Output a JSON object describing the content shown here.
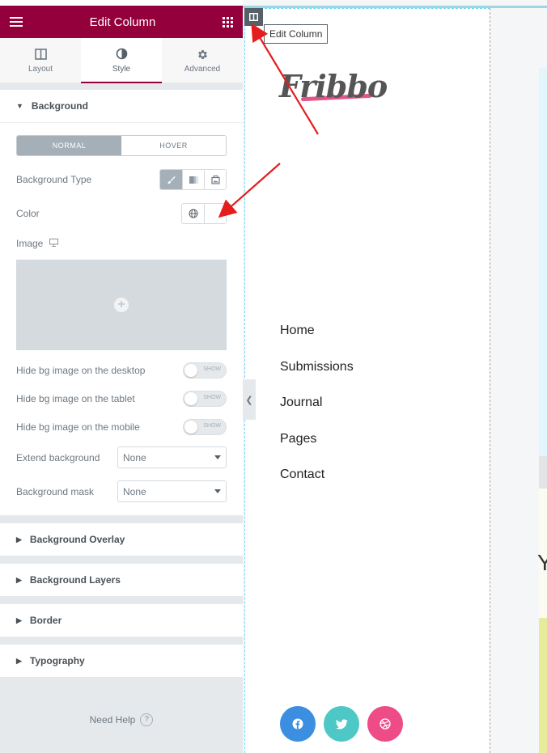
{
  "panel": {
    "title": "Edit Column",
    "tabs": [
      {
        "label": "Layout",
        "icon": "columns-icon"
      },
      {
        "label": "Style",
        "icon": "half-circle-icon",
        "active": true
      },
      {
        "label": "Advanced",
        "icon": "gear-icon"
      }
    ],
    "background": {
      "heading": "Background",
      "state_tabs": [
        "NORMAL",
        "HOVER"
      ],
      "bg_type_label": "Background Type",
      "color_label": "Color",
      "image_label": "Image",
      "toggles": [
        {
          "label": "Hide bg image on the desktop",
          "state": "SHOW"
        },
        {
          "label": "Hide bg image on the tablet",
          "state": "SHOW"
        },
        {
          "label": "Hide bg image on the mobile",
          "state": "SHOW"
        }
      ],
      "extend_label": "Extend background",
      "extend_value": "None",
      "mask_label": "Background mask",
      "mask_value": "None"
    },
    "sections": [
      "Background Overlay",
      "Background Layers",
      "Border",
      "Typography"
    ],
    "help": "Need Help"
  },
  "preview": {
    "tooltip": "Edit Column",
    "logo": "Fribbo",
    "nav": [
      "Home",
      "Submissions",
      "Journal",
      "Pages",
      "Contact"
    ],
    "partial_letter": "Y",
    "social": [
      {
        "icon": "facebook-icon",
        "color": "#3b8ee0"
      },
      {
        "icon": "twitter-icon",
        "color": "#4ec7c7"
      },
      {
        "icon": "dribbble-icon",
        "color": "#ee4c86"
      }
    ]
  },
  "colors": {
    "brand": "#93003c",
    "arrow": "#e41e1e"
  }
}
